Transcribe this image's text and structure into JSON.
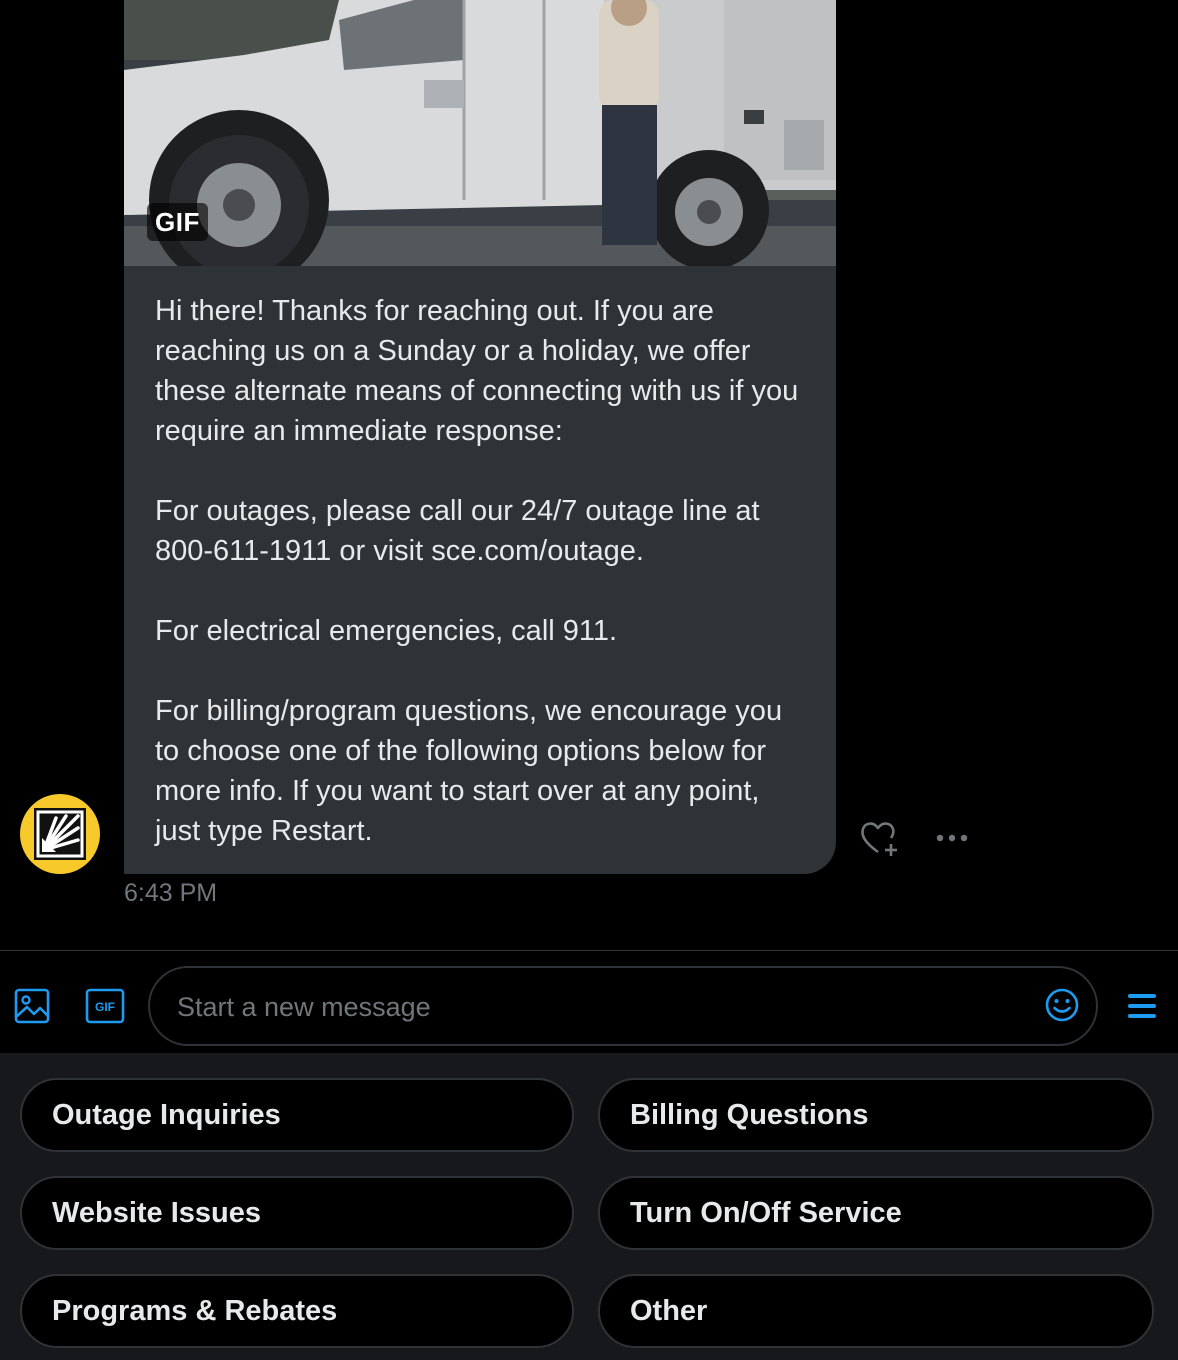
{
  "message": {
    "media_badge": "GIF",
    "paragraphs": [
      "Hi there! Thanks for reaching out. If you are reaching us on a Sunday or a holiday, we offer these alternate means of connecting with us if you require an immediate response:",
      "For outages, please call our 24/7 outage line at 800-611-1911 or visit sce.com/outage.",
      "For electrical emergencies, call 911.",
      "For billing/program questions, we encourage you to choose one of the following options below for more info. If you want to start over at any point, just type Restart."
    ],
    "timestamp": "6:43 PM",
    "avatar_icon": "sce-logo-icon",
    "react_icon": "heart-plus-icon",
    "more_icon": "more-dots-icon"
  },
  "composer": {
    "placeholder": "Start a new message",
    "media_icon": "image-icon",
    "gif_icon": "gif-icon",
    "gif_icon_label": "GIF",
    "emoji_icon": "smiley-icon",
    "menu_icon": "menu-icon"
  },
  "quick_replies": [
    {
      "label": "Outage Inquiries"
    },
    {
      "label": "Billing Questions"
    },
    {
      "label": "Website Issues"
    },
    {
      "label": "Turn On/Off Service"
    },
    {
      "label": "Programs & Rebates"
    },
    {
      "label": "Other"
    }
  ],
  "colors": {
    "background": "#000000",
    "bubble": "#2f3336",
    "accent": "#1d9bf0",
    "avatar": "#f7c92b",
    "muted_text": "#71767b",
    "border": "#2f3336"
  }
}
